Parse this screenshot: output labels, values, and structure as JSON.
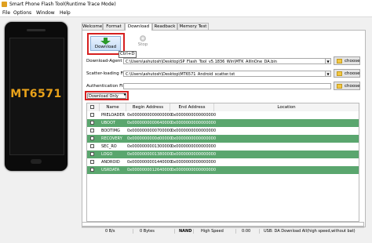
{
  "window": {
    "title": "Smart Phone Flash Tool(Runtime Trace Mode)"
  },
  "menu": [
    "File",
    "Options",
    "Window",
    "Help"
  ],
  "phone": {
    "chip_label": "MT6571"
  },
  "tabs": [
    "Welcome",
    "Format",
    "Download",
    "Readback",
    "Memory Test"
  ],
  "active_tab": "Download",
  "toolbar": {
    "download_label": "Download",
    "stop_label": "Stop",
    "shortcut": "Ctrl+D"
  },
  "fields": {
    "download_agent": {
      "label": "Download-Agent",
      "value": "C:\\Users\\ashutosh\\Desktop\\SP_Flash_Tool_v5.1836_Win\\MTK_AllInOne_DA.bin"
    },
    "scatter": {
      "label": "Scatter-loading File",
      "value": "C:\\Users\\ashutosh\\Desktop\\MT6571_Android_scatter.txt"
    },
    "auth": {
      "label": "Authentication File",
      "value": ""
    },
    "choose_label": "choose"
  },
  "download_mode": {
    "selected": "Download Only"
  },
  "table": {
    "headers": [
      "",
      "Name",
      "Begin Address",
      "End Address",
      "Location"
    ],
    "rows": [
      {
        "name": "PRELOADER",
        "begin": "0x0000000000000000",
        "end": "0x0000000000000000",
        "location": "",
        "style": "white"
      },
      {
        "name": "UBOOT",
        "begin": "0x0000000000640000",
        "end": "0x0000000000000000",
        "location": "",
        "style": "green"
      },
      {
        "name": "BOOTIMG",
        "begin": "0x0000000000700000",
        "end": "0x0000000000000000",
        "location": "",
        "style": "white"
      },
      {
        "name": "RECOVERY",
        "begin": "0x0000000000d00000",
        "end": "0x0000000000000000",
        "location": "",
        "style": "green"
      },
      {
        "name": "SEC_RO",
        "begin": "0x0000000001300000",
        "end": "0x0000000000000000",
        "location": "",
        "style": "white"
      },
      {
        "name": "LOGO",
        "begin": "0x0000000001380000",
        "end": "0x0000000000000000",
        "location": "",
        "style": "green"
      },
      {
        "name": "ANDROID",
        "begin": "0x0000000001440000",
        "end": "0x0000000000000000",
        "location": "",
        "style": "white"
      },
      {
        "name": "USRDATA",
        "begin": "0x0000000012640000",
        "end": "0x0000000000000000",
        "location": "",
        "style": "green"
      }
    ]
  },
  "status": {
    "speed": "0 B/s",
    "bytes": "0 Bytes",
    "storage": "NAND",
    "usb_speed": "High Speed",
    "time": "0:00",
    "message": "USB: DA Download All(high speed,without bat)"
  },
  "colors": {
    "row_green": "#5aa66e",
    "highlight_red": "#d62020",
    "chip_text": "#e9a21a"
  }
}
